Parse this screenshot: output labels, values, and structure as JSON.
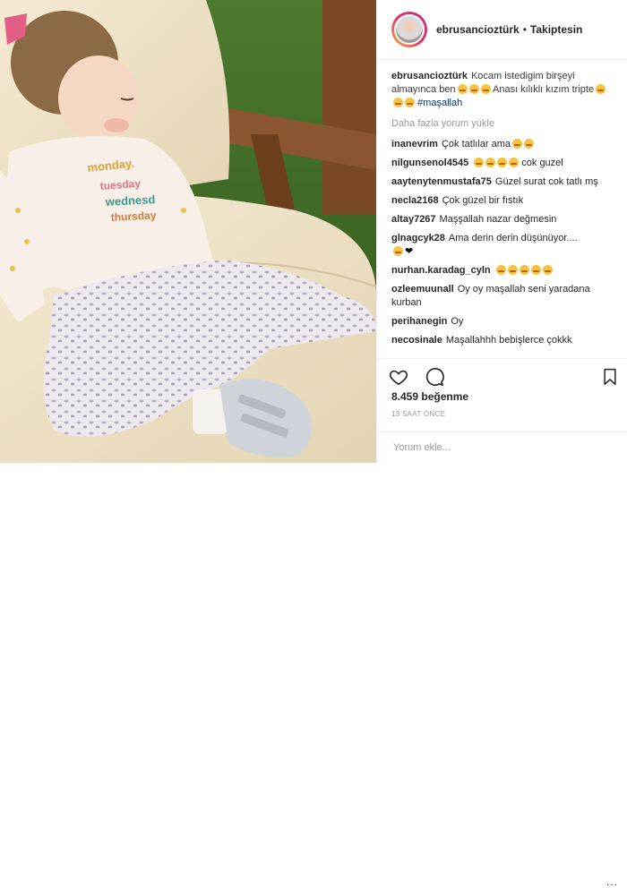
{
  "post": {
    "username": "ebrusancioztürk",
    "follow_status": "Takiptesin",
    "separator": "•",
    "caption": {
      "username": "ebrusancioztürk",
      "text": "Kocam istedigim birşeyi almayınca ben",
      "text2": "Anası kılıklı kızım tripte",
      "hashtag": "#maşallah"
    },
    "load_more": "Daha fazla yorum yükle",
    "comments": [
      {
        "username": "inanevrim",
        "text": "Çok tatlılar ama"
      },
      {
        "username": "nilgunsenol4545",
        "text": "cok guzel"
      },
      {
        "username": "aaytenytenmustafa75",
        "text": "Güzel surat cok tatlı mş"
      },
      {
        "username": "necla2168",
        "text": "Çok güzel bir fıstık"
      },
      {
        "username": "altay7267",
        "text": "Maşşallah nazar değmesin"
      },
      {
        "username": "glnagcyk28",
        "text": "Ama derin derin düşünüyor...."
      },
      {
        "username": "nurhan.karadag_cyln",
        "text": ""
      },
      {
        "username": "ozleemuunall",
        "text": "Oy oy maşallah seni yaradana kurban"
      },
      {
        "username": "perihanegin",
        "text": "Oy"
      },
      {
        "username": "necosinale",
        "text": "Maşallahhh bebişlerce çokkk"
      }
    ],
    "likes": "8.459 beğenme",
    "time_ago": "13 SAAT ÖNCE",
    "comment_placeholder": "Yorum ekle...",
    "more_menu": "..."
  },
  "icons": [
    "heart-icon",
    "comment-icon",
    "bookmark-icon"
  ],
  "colors": {
    "hashtag": "#003569",
    "muted": "#999999",
    "text": "#262626"
  }
}
